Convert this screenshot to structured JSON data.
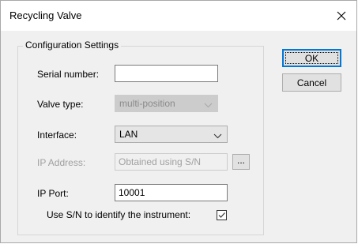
{
  "window": {
    "title": "Recycling Valve",
    "close_icon": "close-icon"
  },
  "group": {
    "title": "Configuration Settings"
  },
  "fields": {
    "serial_number": {
      "label": "Serial number:",
      "value": ""
    },
    "valve_type": {
      "label": "Valve type:",
      "value": "multi-position",
      "enabled": false
    },
    "interface": {
      "label": "Interface:",
      "value": "LAN",
      "enabled": true
    },
    "ip_address": {
      "label": "IP Address:",
      "value": "Obtained using S/N",
      "enabled": false,
      "browse_label": "..."
    },
    "ip_port": {
      "label": "IP Port:",
      "value": "10001"
    },
    "use_sn": {
      "label": "Use S/N to identify the instrument:",
      "checked": true
    }
  },
  "buttons": {
    "ok": "OK",
    "cancel": "Cancel"
  },
  "colors": {
    "accent": "#0078d7",
    "dialog_bg": "#f0f0f0",
    "disabled_text": "#a0a0a0"
  }
}
